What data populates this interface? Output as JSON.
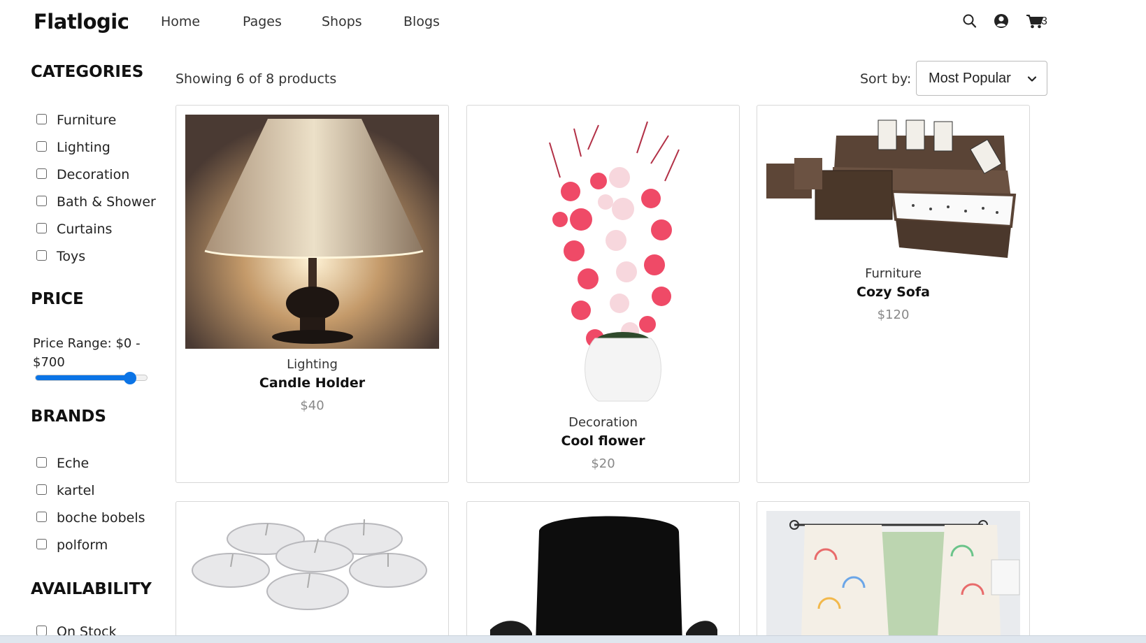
{
  "header": {
    "logo": "Flatlogic",
    "nav": [
      "Home",
      "Pages",
      "Shops",
      "Blogs"
    ],
    "cart_count": "3",
    "icons": [
      "search-icon",
      "user-circle-icon",
      "cart-icon"
    ]
  },
  "sidebar": {
    "categories_title": "CATEGORIES",
    "categories": [
      "Furniture",
      "Lighting",
      "Decoration",
      "Bath & Shower",
      "Curtains",
      "Toys"
    ],
    "price_title": "PRICE",
    "price_range_text": "Price Range: $0 - $700",
    "price_slider_fraction": 0.85,
    "brands_title": "BRANDS",
    "brands": [
      "Eche",
      "kartel",
      "boche bobels",
      "polform"
    ],
    "availability_title": "AVAILABILITY",
    "availability": [
      "On Stock"
    ]
  },
  "main": {
    "showing": "Showing 6 of 8 products",
    "sort_label": "Sort by:",
    "sort_value": "Most Popular",
    "products": [
      {
        "category": "Lighting",
        "name": "Candle Holder",
        "price": "$40"
      },
      {
        "category": "Decoration",
        "name": "Cool flower",
        "price": "$20"
      },
      {
        "category": "Furniture",
        "name": "Cozy Sofa",
        "price": "$120"
      },
      {
        "category": "",
        "name": "",
        "price": ""
      },
      {
        "category": "",
        "name": "",
        "price": ""
      },
      {
        "category": "",
        "name": "",
        "price": ""
      }
    ]
  },
  "colors": {
    "accent": "#0b74e6",
    "price_text": "#888888",
    "border": "#d8d8d8"
  }
}
